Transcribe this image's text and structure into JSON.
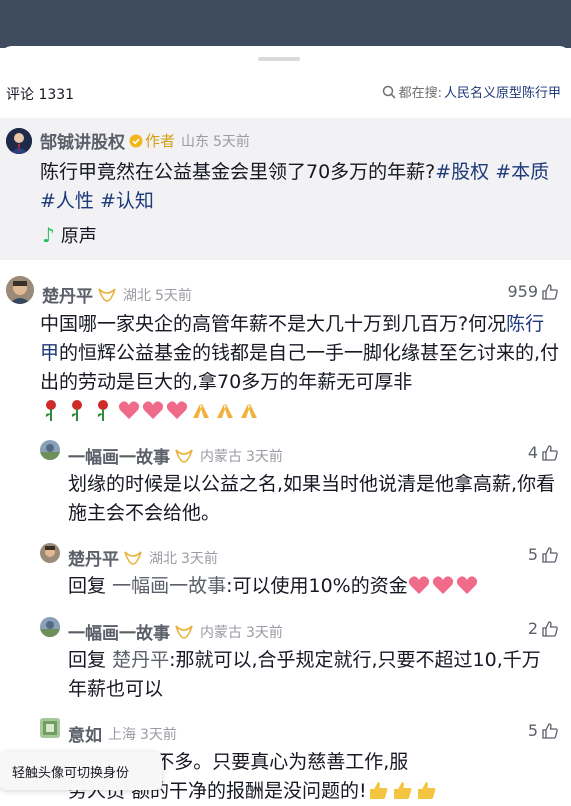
{
  "header": {
    "comment_count": "评论 1331",
    "search_prefix": "都在搜:",
    "search_keyword": "人民名义原型陈行甲"
  },
  "pinned": {
    "author_name": "郜铖讲股权",
    "author_tag": "作者",
    "location": "山东",
    "time": "5天前",
    "text_main": "陈行甲竟然在公益基金会里领了70多万的年薪?",
    "hashtags": [
      "#股权",
      "#本质",
      "#人性",
      "#认知"
    ],
    "original_sound": "原声"
  },
  "comments": [
    {
      "name": "楚丹平",
      "location": "湖北",
      "time": "5天前",
      "likes": "959",
      "text_a": "中国哪一家央企的高管年薪不是大几十万到几百万?何况",
      "mention": "陈行甲",
      "text_b": "的恒辉公益基金的钱都是自己一手一脚化缘甚至乞讨来的,付出的劳动是巨大的,拿70多万的年薪无可厚非"
    }
  ],
  "replies": [
    {
      "name": "一幅画一故事",
      "location": "内蒙古",
      "time": "3天前",
      "likes": "4",
      "text": "划缘的时候是以公益之名,如果当时他说清是他拿高薪,你看施主会不会给他。"
    },
    {
      "name": "楚丹平",
      "location": "湖北",
      "time": "3天前",
      "likes": "5",
      "reply_label": "回复",
      "reply_to": "一幅画一故事",
      "text": ":可以使用10%的资金"
    },
    {
      "name": "一幅画一故事",
      "location": "内蒙古",
      "time": "3天前",
      "likes": "2",
      "reply_label": "回复",
      "reply_to": "楚丹平",
      "text": ":那就可以,合乎规定就行,只要不超过10,千万年薪也可以"
    },
    {
      "name": "意如",
      "location": "上海",
      "time": "3天前",
      "likes": "5",
      "text_line1": "薪73万元,不多。只要真心为慈善工作,服",
      "text_line2": "务人员    额的干净的报酬是没问题的!"
    }
  ],
  "toast": "轻触头像可切换身份",
  "colors": {
    "topbar": "#3f4b5f",
    "link": "#1f3a7a",
    "username": "#5b5f69",
    "meta": "#9a9ca3",
    "author_tag": "#d6a014",
    "music_note": "#20c060"
  },
  "icons": [
    "search-icon",
    "verified-icon",
    "music-note-icon",
    "fan-badge-icon",
    "like-icon",
    "rose-emoji",
    "heart-emoji",
    "pray-emoji",
    "thumbs-up-emoji"
  ]
}
